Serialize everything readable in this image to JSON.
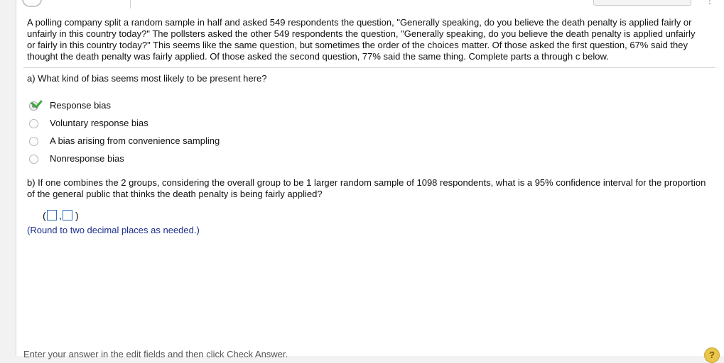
{
  "problem": {
    "stem": "A polling company split a random sample in half and asked 549 respondents the question, \"Generally speaking, do you believe the death penalty is applied fairly or unfairly in this country today?\" The pollsters asked the other 549 respondents the question, \"Generally speaking, do you believe the death penalty is applied unfairly or fairly in this country today?\" This seems like the same question, but sometimes the order of the choices matter. Of those asked the first question, 67% said they thought the death penalty was fairly applied. Of those asked the second question, 77% said the same thing. Complete parts a through c below."
  },
  "part_a": {
    "question": "a) What kind of bias seems most likely to be present here?",
    "options": [
      {
        "label": "Response bias",
        "selected": true,
        "correct": true
      },
      {
        "label": "Voluntary response bias",
        "selected": false
      },
      {
        "label": "A bias arising from convenience sampling",
        "selected": false
      },
      {
        "label": "Nonresponse bias",
        "selected": false
      }
    ]
  },
  "part_b": {
    "question": "b) If one combines the 2 groups, considering the overall group to be 1 larger random sample of 1098 respondents, what is a 95% confidence interval for the proportion of the general public that thinks the death penalty is being fairly applied?",
    "open_paren": "(",
    "comma": ",",
    "close_paren": ")",
    "lower_value": "",
    "upper_value": "",
    "hint": "(Round to two decimal places as needed.)"
  },
  "footer": {
    "instruction": "Enter your answer in the edit fields and then click Check Answer.",
    "help_symbol": "?"
  },
  "colors": {
    "answer_box_border": "#2d6fc0",
    "hint_text": "#1a2f8c",
    "check_mark": "#3caa3c"
  }
}
